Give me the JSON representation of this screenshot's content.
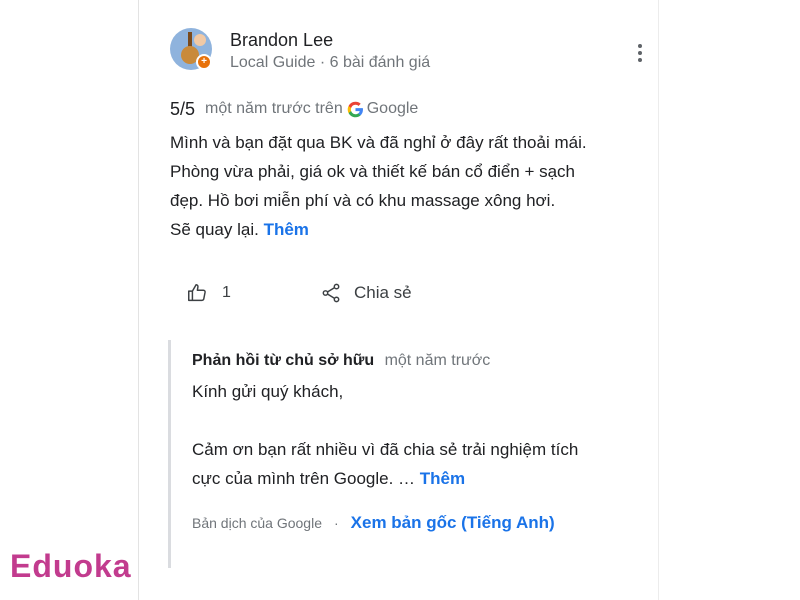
{
  "review": {
    "reviewer_name": "Brandon Lee",
    "reviewer_meta": "Local Guide · 6 bài đánh giá",
    "rating": "5/5",
    "time": "một năm trước trên",
    "source": "Google",
    "text_lines": [
      "Mình và bạn đặt qua BK và đã nghỉ ở đây rất thoải mái.",
      "Phòng vừa phải, giá ok và thiết kế bán cổ điển + sạch",
      "đẹp. Hồ bơi miễn phí và có khu massage xông hơi.",
      "Sẽ quay lại."
    ],
    "more_label": "Thêm",
    "like_count": "1",
    "share_label": "Chia sẻ"
  },
  "owner_response": {
    "title": "Phản hồi từ chủ sở hữu",
    "time": "một năm trước",
    "greeting": "Kính gửi quý khách,",
    "text_line1": "Cảm ơn bạn rất nhiều vì đã chia sẻ trải nghiệm tích",
    "text_line2": "cực của mình trên Google. …",
    "more_label": "Thêm",
    "translated_note": "Bản dịch của Google",
    "separator": "·",
    "see_original": "Xem bản gốc (Tiếng Anh)"
  },
  "watermark": {
    "text": "Eduoka"
  },
  "colors": {
    "link": "#1a73e8",
    "text": "#202124",
    "muted": "#70757a",
    "local_guide_badge": "#e8710a",
    "watermark": "#c23b8e"
  },
  "icons": [
    "more-vert-icon",
    "google-g-icon",
    "thumb-up-icon",
    "share-icon",
    "local-guide-badge-icon"
  ]
}
